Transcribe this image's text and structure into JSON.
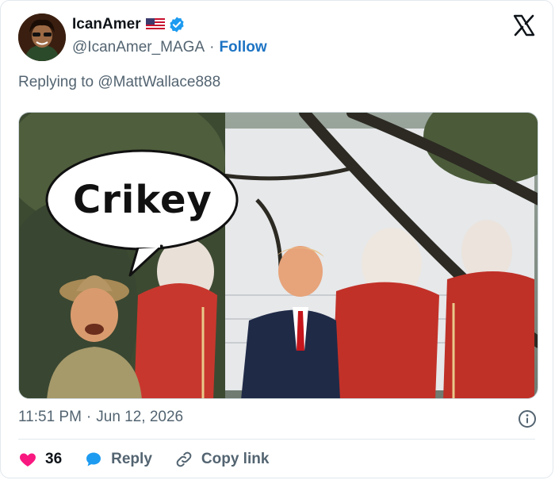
{
  "tweet": {
    "display_name": "IcanAmer",
    "handle": "@IcanAmer_MAGA",
    "separator": "·",
    "follow_label": "Follow",
    "reply_context": "Replying to @MattWallace888",
    "speech_bubble_text": "Crikey",
    "time": "11:51 PM",
    "date": "Jun 12, 2026",
    "like_count": "36",
    "reply_label": "Reply",
    "copy_link_label": "Copy link"
  },
  "icons": {
    "verified": "verified-badge-icon",
    "flag": "us-flag-icon",
    "logo": "x-logo-icon",
    "info": "info-icon",
    "like": "heart-icon",
    "reply": "speech-bubble-icon",
    "copy": "link-icon"
  },
  "colors": {
    "accent": "#1d74c4",
    "like": "#f91880",
    "verified": "#1d9bf0",
    "secondary_text": "#536471"
  }
}
